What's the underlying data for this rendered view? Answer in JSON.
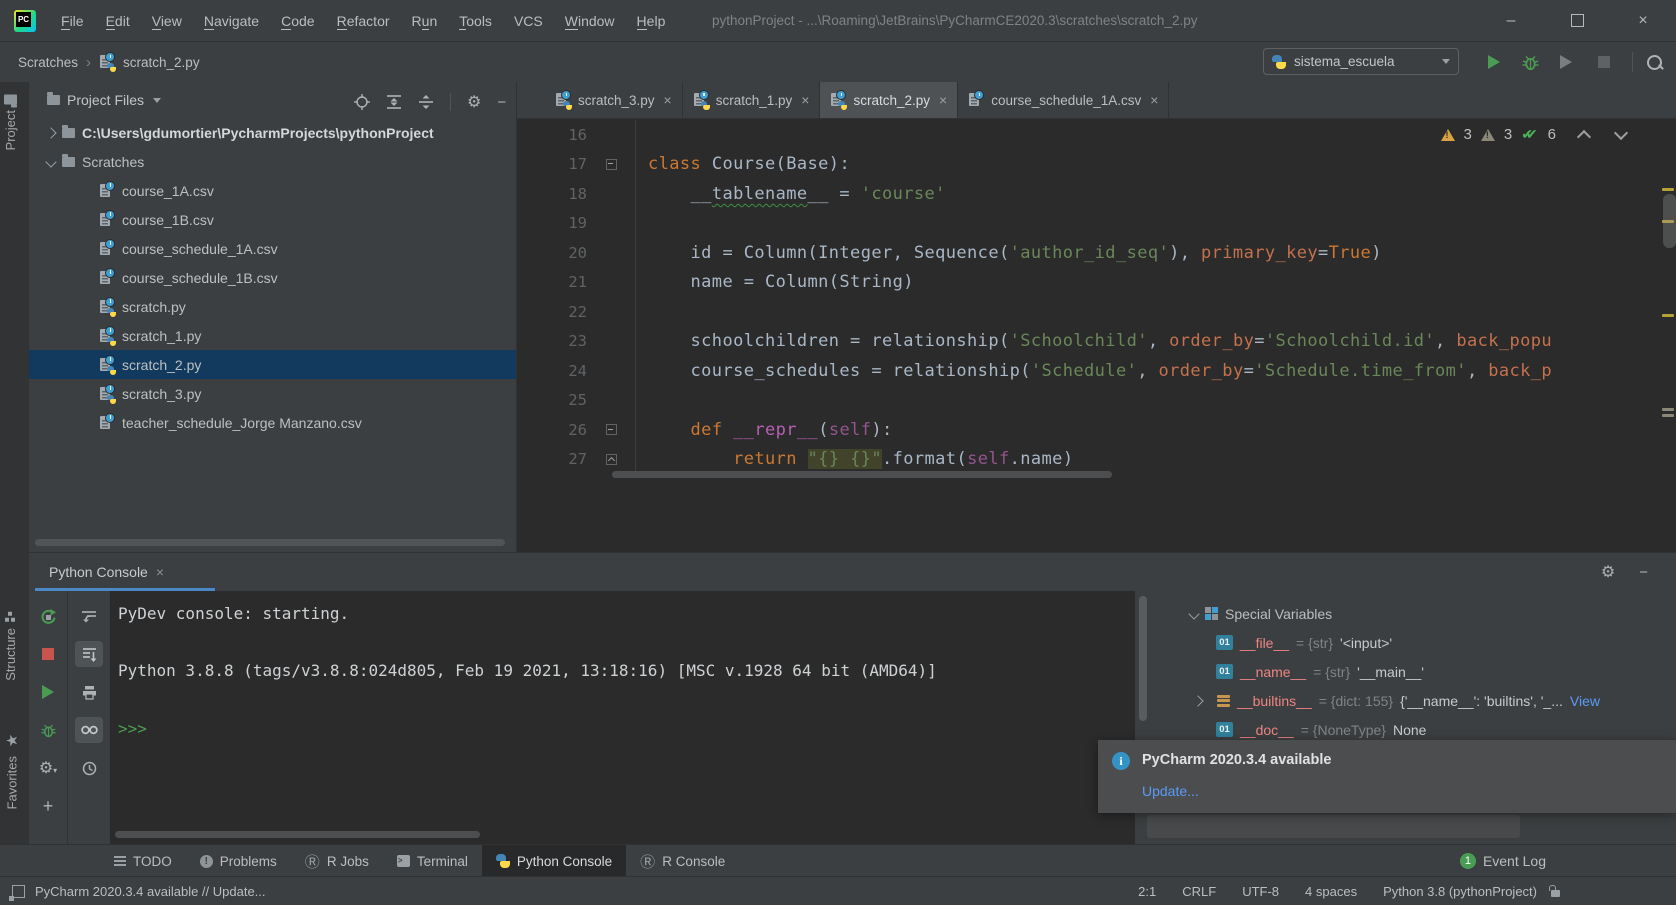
{
  "colors": {
    "panel": "#3c3f41",
    "editor_bg": "#2b2b2b",
    "selection": "#123a5e",
    "tab_underline": "#4a88c7",
    "keyword": "#cc7832",
    "string": "#6a8759",
    "named_param": "#c4714d",
    "link": "#5b9bf5",
    "warning": "#d9a343",
    "ok_green": "#4a9c54",
    "error_stop": "#c75450"
  },
  "title_bar": {
    "menus": [
      {
        "label": "File",
        "u": 0
      },
      {
        "label": "Edit",
        "u": 0
      },
      {
        "label": "View",
        "u": 0
      },
      {
        "label": "Navigate",
        "u": 0
      },
      {
        "label": "Code",
        "u": 0
      },
      {
        "label": "Refactor",
        "u": 0
      },
      {
        "label": "Run",
        "u": 1
      },
      {
        "label": "Tools",
        "u": 0
      },
      {
        "label": "VCS",
        "u": -1
      },
      {
        "label": "Window",
        "u": 0
      },
      {
        "label": "Help",
        "u": 0
      }
    ],
    "title": "pythonProject - ...\\Roaming\\JetBrains\\PyCharmCE2020.3\\scratches\\scratch_2.py"
  },
  "window_controls": {
    "minimize": "–",
    "close": "×"
  },
  "toolbar": {
    "breadcrumbs": [
      {
        "label": "Scratches"
      },
      {
        "label": "scratch_2.py",
        "icon": "py"
      }
    ],
    "run_config": "sistema_escuela"
  },
  "project_panel": {
    "header": "Project Files",
    "root": "C:\\Users\\gdumortier\\PycharmProjects\\pythonProject",
    "folder": "Scratches",
    "files": [
      {
        "name": "course_1A.csv",
        "type": "csv"
      },
      {
        "name": "course_1B.csv",
        "type": "csv"
      },
      {
        "name": "course_schedule_1A.csv",
        "type": "csv"
      },
      {
        "name": "course_schedule_1B.csv",
        "type": "csv"
      },
      {
        "name": "scratch.py",
        "type": "py"
      },
      {
        "name": "scratch_1.py",
        "type": "py"
      },
      {
        "name": "scratch_2.py",
        "type": "py",
        "selected": true
      },
      {
        "name": "scratch_3.py",
        "type": "py"
      },
      {
        "name": "teacher_schedule_Jorge Manzano.csv",
        "type": "csv"
      }
    ]
  },
  "editor": {
    "tabs": [
      {
        "label": "scratch_3.py",
        "type": "py"
      },
      {
        "label": "scratch_1.py",
        "type": "py"
      },
      {
        "label": "scratch_2.py",
        "type": "py",
        "active": true
      },
      {
        "label": "course_schedule_1A.csv",
        "type": "csv"
      }
    ],
    "inspections": {
      "warnings": "3",
      "weak_warnings": "3",
      "typos": "6"
    },
    "lines": [
      {
        "n": "16",
        "tokens": []
      },
      {
        "n": "17",
        "fold": "top",
        "tokens": [
          [
            "kw",
            "class"
          ],
          [
            "pl",
            " Course(Base):"
          ]
        ]
      },
      {
        "n": "18",
        "tokens": [
          [
            "pl",
            "    __"
          ],
          [
            "typo",
            "tablename"
          ],
          [
            "pl",
            "__ = "
          ],
          [
            "str",
            "'course'"
          ]
        ]
      },
      {
        "n": "19",
        "tokens": []
      },
      {
        "n": "20",
        "tokens": [
          [
            "pl",
            "    id = Column(Integer, Sequence("
          ],
          [
            "str",
            "'author_id_seq'"
          ],
          [
            "pl",
            "), "
          ],
          [
            "param",
            "primary_key"
          ],
          [
            "pl",
            "="
          ],
          [
            "kw",
            "True"
          ],
          [
            "pl",
            ")"
          ]
        ]
      },
      {
        "n": "21",
        "tokens": [
          [
            "pl",
            "    name = Column(String)"
          ]
        ]
      },
      {
        "n": "22",
        "tokens": []
      },
      {
        "n": "23",
        "tokens": [
          [
            "pl",
            "    schoolchildren = relationship("
          ],
          [
            "str",
            "'Schoolchild'"
          ],
          [
            "pl",
            ", "
          ],
          [
            "param",
            "order_by"
          ],
          [
            "pl",
            "="
          ],
          [
            "str",
            "'Schoolchild.id'"
          ],
          [
            "pl",
            ", "
          ],
          [
            "param",
            "back_popu"
          ]
        ]
      },
      {
        "n": "24",
        "tokens": [
          [
            "pl",
            "    course_schedules = relationship("
          ],
          [
            "str",
            "'Schedule'"
          ],
          [
            "pl",
            ", "
          ],
          [
            "param",
            "order_by"
          ],
          [
            "pl",
            "="
          ],
          [
            "str",
            "'Schedule.time_from'"
          ],
          [
            "pl",
            ", "
          ],
          [
            "param",
            "back_p"
          ]
        ]
      },
      {
        "n": "25",
        "tokens": []
      },
      {
        "n": "26",
        "fold": "down",
        "tokens": [
          [
            "pl",
            "    "
          ],
          [
            "kw",
            "def"
          ],
          [
            "pl",
            " "
          ],
          [
            "mag",
            "__repr__"
          ],
          [
            "pl",
            "("
          ],
          [
            "self",
            "self"
          ],
          [
            "pl",
            "):"
          ]
        ]
      },
      {
        "n": "27",
        "fold": "up",
        "tokens": [
          [
            "pl",
            "        "
          ],
          [
            "kw",
            "return"
          ],
          [
            "pl",
            " "
          ],
          [
            "strhl",
            "\"{} {}\""
          ],
          [
            "pl",
            ".format("
          ],
          [
            "self",
            "self"
          ],
          [
            "pl",
            ".name)"
          ]
        ]
      }
    ]
  },
  "left_stripe": {
    "top": "Project",
    "bottom": [
      "Structure",
      "Favorites"
    ]
  },
  "console": {
    "tab": "Python Console",
    "lines": [
      "PyDev console: starting.",
      "Python 3.8.8 (tags/v3.8.8:024d805, Feb 19 2021, 13:18:16) [MSC v.1928 64 bit (AMD64)]"
    ],
    "prompt": ">>>"
  },
  "variables": {
    "header": "Special Variables",
    "rows": [
      {
        "badge": "01",
        "name": "__file__",
        "type": "{str}",
        "value": "'<input>'"
      },
      {
        "badge": "01",
        "name": "__name__",
        "type": "{str}",
        "value": "'__main__'"
      },
      {
        "badge": "dict",
        "expand": true,
        "name": "__builtins__",
        "type": "{dict: 155}",
        "value": "{'__name__': 'builtins', '_...",
        "link": "View"
      },
      {
        "badge": "01",
        "name": "__doc__",
        "type": "{NoneType}",
        "value": "None"
      }
    ]
  },
  "notification": {
    "title": "PyCharm 2020.3.4 available",
    "link": "Update..."
  },
  "bottom_bar": {
    "tabs": [
      {
        "label": "TODO",
        "icon": "todo"
      },
      {
        "label": "Problems",
        "icon": "problems"
      },
      {
        "label": "R Jobs",
        "icon": "r"
      },
      {
        "label": "Terminal",
        "icon": "terminal"
      },
      {
        "label": "Python Console",
        "icon": "py",
        "active": true
      },
      {
        "label": "R Console",
        "icon": "r"
      }
    ],
    "event_log": {
      "label": "Event Log",
      "badge": "1"
    }
  },
  "status_bar": {
    "message": "PyCharm 2020.3.4 available // Update...",
    "items": [
      "2:1",
      "CRLF",
      "UTF-8",
      "4 spaces",
      "Python 3.8 (pythonProject)"
    ]
  }
}
